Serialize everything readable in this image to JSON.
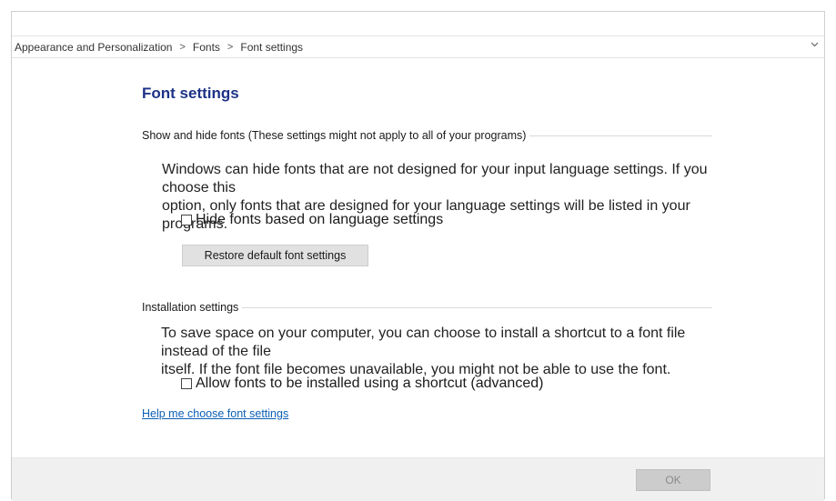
{
  "breadcrumb": {
    "items": [
      "Appearance and Personalization",
      "Fonts",
      "Font settings"
    ],
    "separator": ">",
    "dropdown_icon": "chevron-down-icon"
  },
  "page": {
    "title": "Font settings"
  },
  "show_hide_section": {
    "heading": "Show and hide fonts (These settings might not apply to all of your programs)",
    "description_line1": "Windows can hide fonts that are not designed for your input language settings. If you choose this",
    "description_line2": "option, only fonts that are designed for your language settings will be listed in your programs.",
    "checkbox_label": "Hide fonts based on language settings",
    "checkbox_checked": false,
    "restore_button": "Restore default font settings"
  },
  "installation_section": {
    "heading": "Installation settings",
    "description_line1": "To save space on your computer, you can choose to install a shortcut to a font file instead of the file",
    "description_line2": "itself. If the font file becomes unavailable, you might not be able to use the font.",
    "checkbox_label": "Allow fonts to be installed using a shortcut (advanced)",
    "checkbox_checked": false
  },
  "help_link": "Help me choose font settings",
  "footer": {
    "ok_label": "OK"
  },
  "colors": {
    "title": "#1e3287",
    "link": "#0b5fb5",
    "footer_bg": "#f0f0f0",
    "button_bg": "#e1e1e1"
  }
}
